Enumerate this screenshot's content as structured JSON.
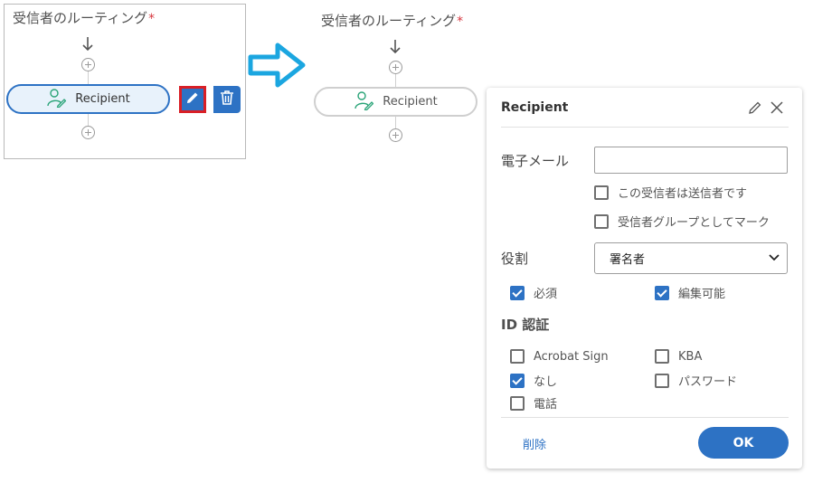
{
  "left_panel": {
    "title": "受信者のルーティング",
    "required_mark": "*",
    "recipient_label": "Recipient"
  },
  "right_panel": {
    "title": "受信者のルーティング",
    "required_mark": "*",
    "recipient_label": "Recipient"
  },
  "dialog": {
    "title": "Recipient",
    "email_label": "電子メール",
    "email_value": "",
    "sender_checkbox_label": "この受信者は送信者です",
    "group_checkbox_label": "受信者グループとしてマーク",
    "role_label": "役割",
    "role_selected": "署名者",
    "required_label": "必須",
    "editable_label": "編集可能",
    "id_auth_label": "ID 認証",
    "auth_options": {
      "acrobat_sign": "Acrobat Sign",
      "kba": "KBA",
      "none": "なし",
      "password": "パスワード",
      "phone": "電話"
    },
    "delete_label": "削除",
    "ok_label": "OK"
  },
  "colors": {
    "accent": "#2d72c4",
    "highlight_border": "#d91f26",
    "required_star": "#d7373f",
    "arrow": "#1ba6e0"
  }
}
